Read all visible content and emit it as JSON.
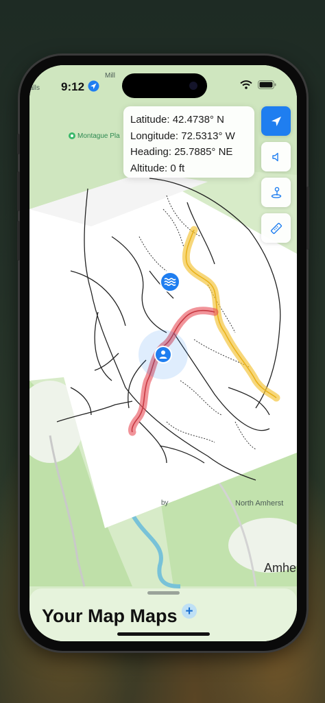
{
  "status_bar": {
    "time": "9:12",
    "location_icon": "location-arrow-icon",
    "wifi_icon": "wifi-icon",
    "battery_icon": "battery-icon"
  },
  "map": {
    "labels": {
      "top_left": "alls",
      "top_center": "Mill",
      "poi": "Montague Pla",
      "bottom_left": "by",
      "north_amherst": "North Amherst",
      "amherst": "Amhe"
    },
    "markers": {
      "water_icon": "water-waves-icon",
      "user_icon": "person-icon"
    },
    "colors": {
      "red_trail": "#e8535c",
      "yellow_trail": "#f2c233",
      "accent": "#1f7ef0",
      "map_green": "#d9eccb"
    }
  },
  "info_panel": {
    "latitude": "Latitude: 42.4738° N",
    "longitude": "Longitude: 72.5313° W",
    "heading": "Heading: 25.7885° NE",
    "altitude": "Altitude: 0 ft"
  },
  "controls": [
    {
      "name": "location-button",
      "icon": "location-arrow-icon",
      "active": true
    },
    {
      "name": "audio-button",
      "icon": "speaker-icon",
      "active": false
    },
    {
      "name": "pin-button",
      "icon": "map-pin-icon",
      "active": false
    },
    {
      "name": "measure-button",
      "icon": "ruler-icon",
      "active": false
    }
  ],
  "sheet": {
    "title": "Your Map Maps",
    "add_label": "+"
  }
}
